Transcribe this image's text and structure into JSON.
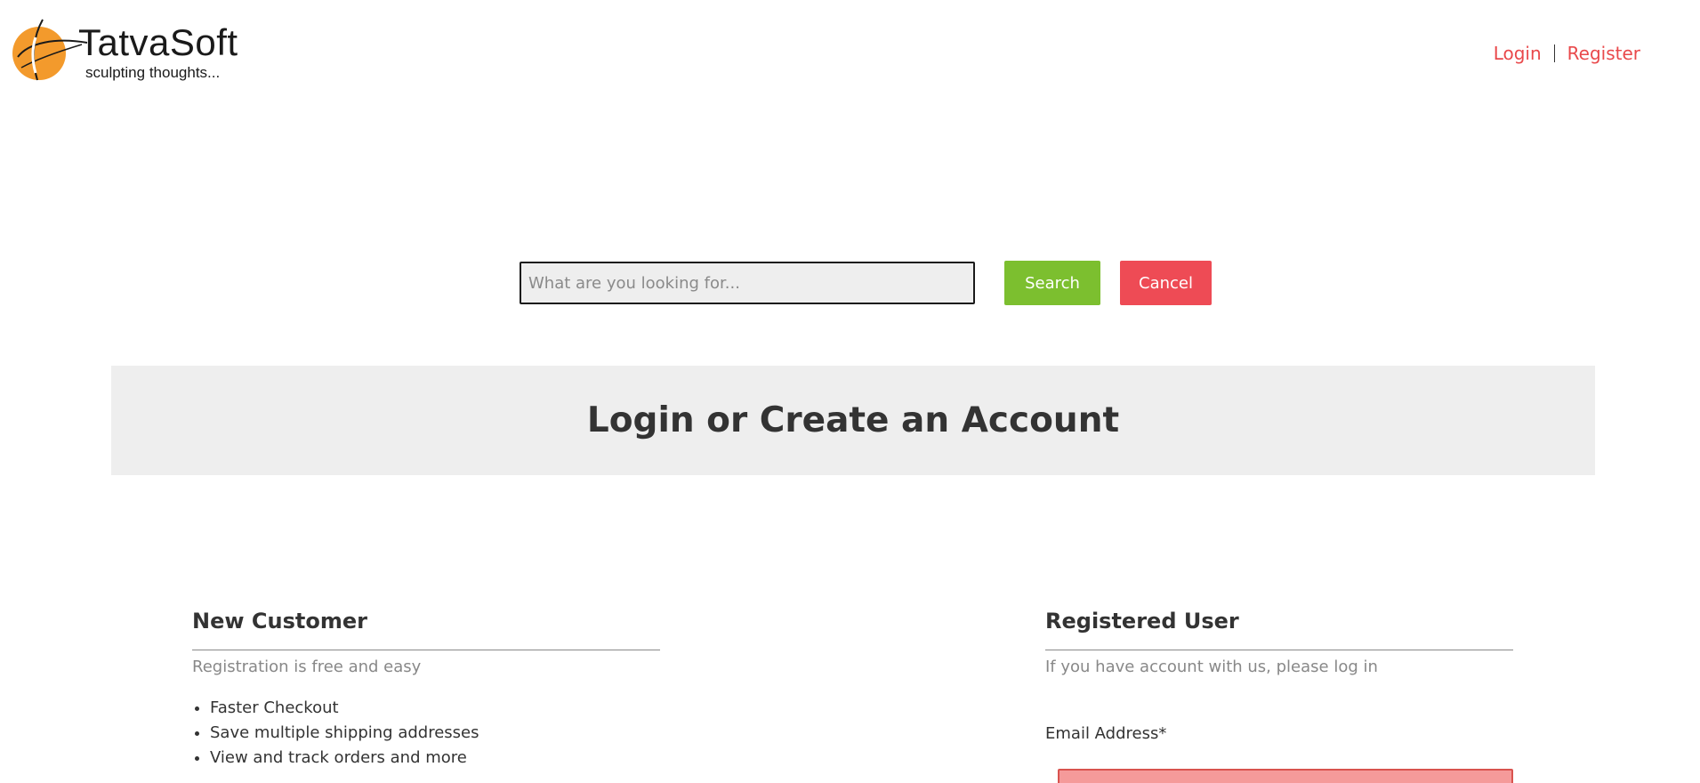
{
  "header": {
    "logo_name": "TatvaSoft",
    "logo_tagline": "sculpting thoughts...",
    "nav": {
      "login": "Login",
      "register": "Register"
    }
  },
  "search": {
    "placeholder": "What are you looking for...",
    "value": "",
    "search_label": "Search",
    "cancel_label": "Cancel"
  },
  "banner": {
    "title": "Login or Create an Account"
  },
  "new_customer": {
    "title": "New Customer",
    "subtitle": "Registration is free and easy",
    "benefits": [
      "Faster Checkout",
      "Save multiple shipping addresses",
      "View and track orders and more"
    ]
  },
  "registered_user": {
    "title": "Registered User",
    "subtitle": "If you have account with us, please log in",
    "email_label": "Email Address*",
    "email_value": ""
  },
  "colors": {
    "accent_red": "#e9494b",
    "search_green": "#7cbf2f",
    "cancel_red": "#ee4b55",
    "logo_orange": "#f39a2c",
    "error_field": "#f59a9a"
  },
  "icons": {
    "logo": "tatvasoft-globe-logo-icon"
  }
}
